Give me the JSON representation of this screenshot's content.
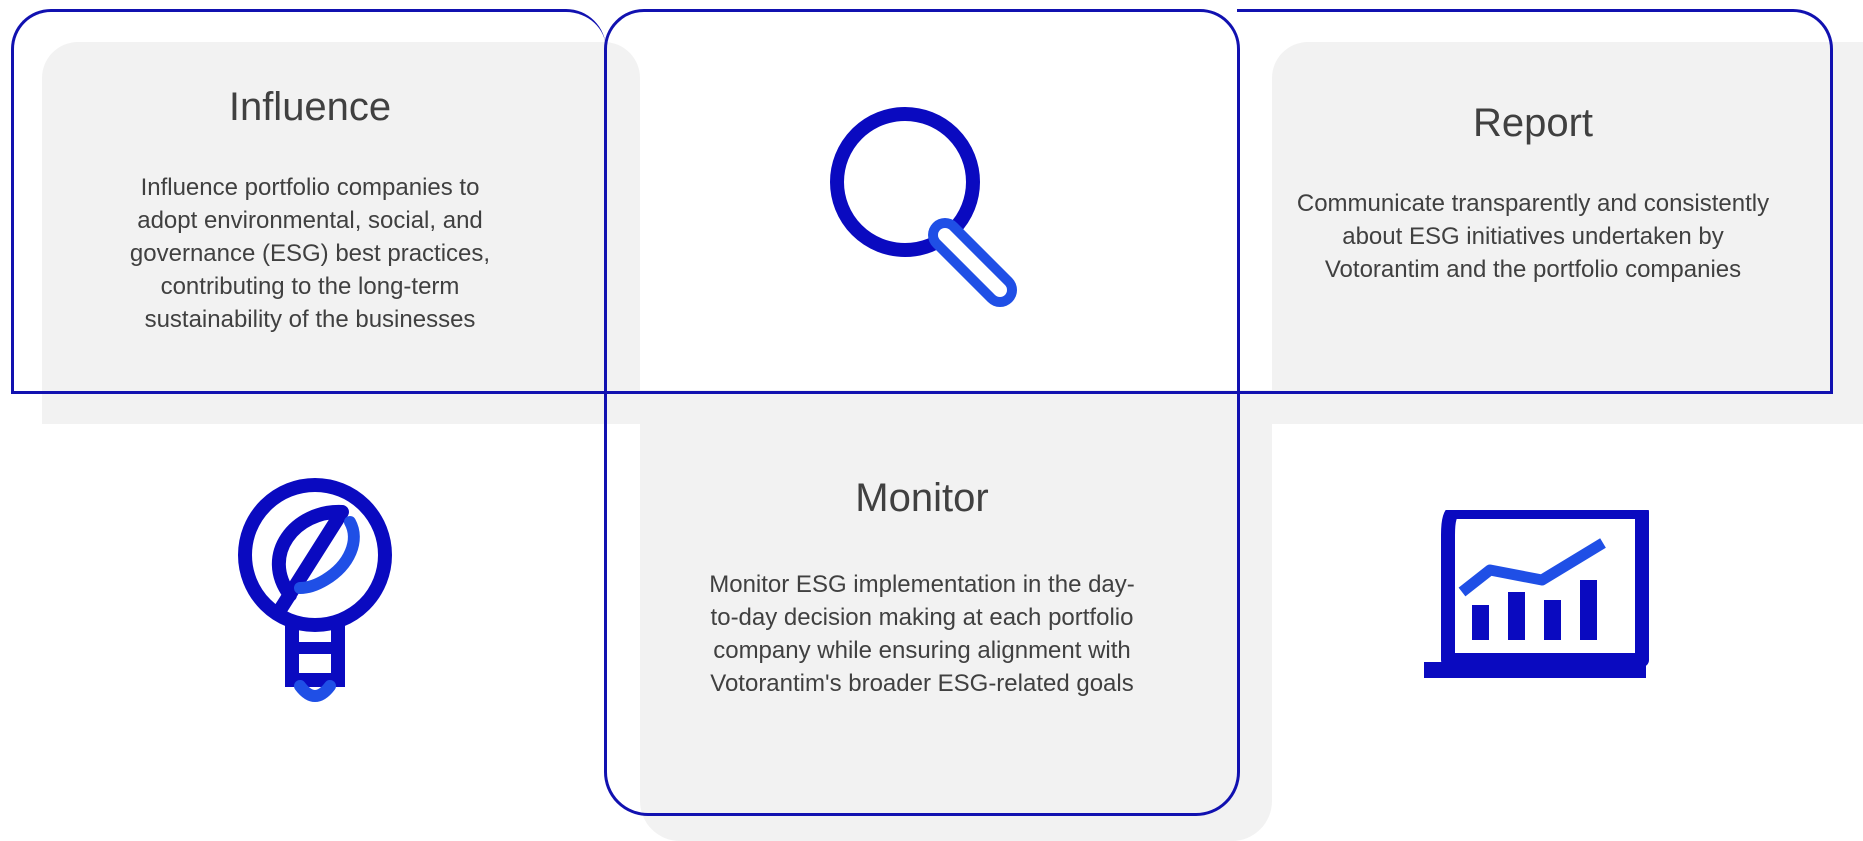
{
  "colors": {
    "outline": "#1111b0",
    "icon_dark": "#0a0ac0",
    "icon_light": "#1f4fe6",
    "panel_background": "#f2f2f2",
    "text": "#404040"
  },
  "steps": [
    {
      "title": "Influence",
      "description": "Influence portfolio companies to adopt environmental, social, and governance (ESG) best practices, contributing to the long-term sustainability of the businesses",
      "icon": "lightbulb-icon"
    },
    {
      "title": "Monitor",
      "description": "Monitor ESG implementation in the day-to-day decision making at each portfolio company while ensuring alignment with Votorantim's broader ESG-related goals",
      "icon": "magnifying-glass-icon"
    },
    {
      "title": "Report",
      "description": "Communicate transparently and consistently about ESG initiatives undertaken by Votorantim and the portfolio companies",
      "icon": "chart-monitor-icon"
    }
  ]
}
